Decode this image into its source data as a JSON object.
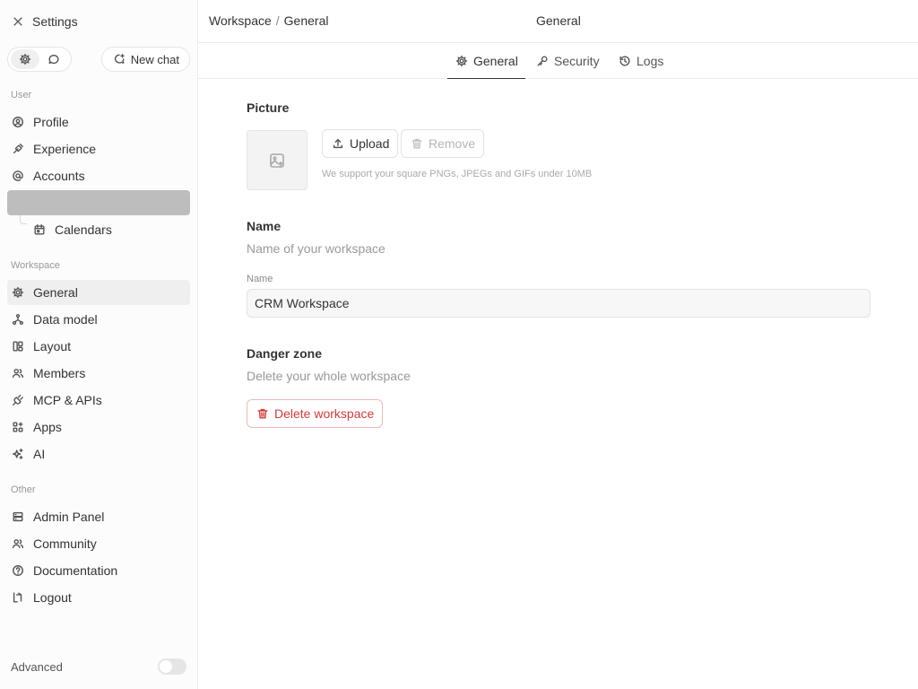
{
  "sidebar": {
    "title": "Settings",
    "new_chat_label": "New chat",
    "sections": {
      "user": "User",
      "workspace": "Workspace",
      "other": "Other"
    },
    "user_items": [
      {
        "label": "Profile",
        "icon": "user-circle-icon"
      },
      {
        "label": "Experience",
        "icon": "palette-icon"
      },
      {
        "label": "Accounts",
        "icon": "at-sign-icon"
      }
    ],
    "accounts_children": [
      {
        "label": ""
      },
      {
        "label": "Calendars",
        "icon": "calendar-icon"
      }
    ],
    "workspace_items": [
      {
        "label": "General",
        "icon": "gear-icon",
        "active": true
      },
      {
        "label": "Data model",
        "icon": "hierarchy-icon"
      },
      {
        "label": "Layout",
        "icon": "layout-icon"
      },
      {
        "label": "Members",
        "icon": "users-icon"
      },
      {
        "label": "MCP & APIs",
        "icon": "plug-icon"
      },
      {
        "label": "Apps",
        "icon": "apps-icon"
      },
      {
        "label": "AI",
        "icon": "sparkles-icon"
      }
    ],
    "other_items": [
      {
        "label": "Admin Panel",
        "icon": "server-icon"
      },
      {
        "label": "Community",
        "icon": "community-icon"
      },
      {
        "label": "Documentation",
        "icon": "help-circle-icon"
      },
      {
        "label": "Logout",
        "icon": "logout-icon"
      }
    ],
    "advanced_label": "Advanced",
    "advanced_enabled": false
  },
  "header": {
    "breadcrumb": [
      "Workspace",
      "General"
    ],
    "breadcrumb_separator": "/",
    "title": "General"
  },
  "tabs": [
    {
      "label": "General",
      "icon": "gear-icon",
      "active": true
    },
    {
      "label": "Security",
      "icon": "key-icon",
      "active": false
    },
    {
      "label": "Logs",
      "icon": "history-icon",
      "active": false
    }
  ],
  "main": {
    "picture": {
      "title": "Picture",
      "upload_label": "Upload",
      "remove_label": "Remove",
      "hint": "We support your square PNGs, JPEGs and GIFs under 10MB"
    },
    "name": {
      "title": "Name",
      "description": "Name of your workspace",
      "field_label": "Name",
      "value": "CRM Workspace"
    },
    "danger": {
      "title": "Danger zone",
      "description": "Delete your whole workspace",
      "delete_label": "Delete workspace"
    }
  },
  "colors": {
    "danger": "#d63b3b",
    "active_bg": "#efefef",
    "highlight_bg": "#bdbdbd"
  }
}
